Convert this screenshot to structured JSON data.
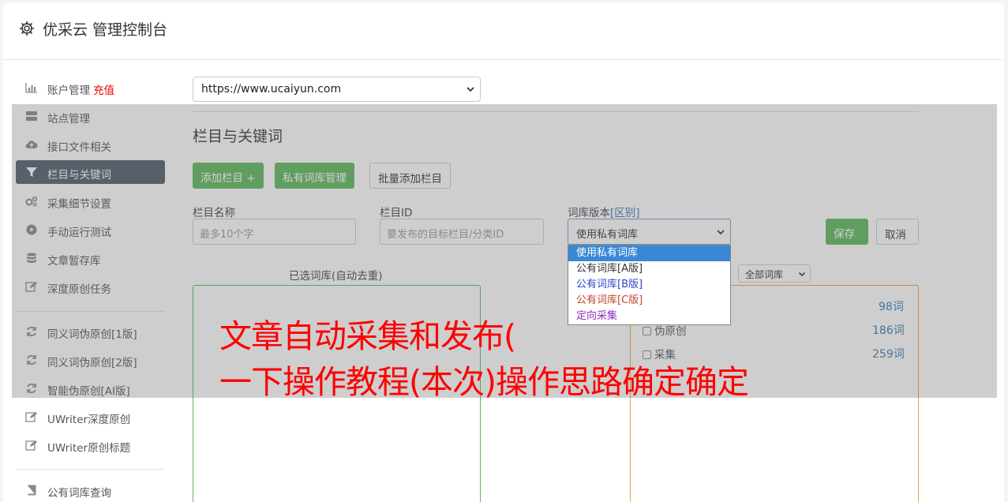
{
  "header": {
    "title": "优采云 管理控制台",
    "icon": "gear-icon"
  },
  "sidebar": {
    "items": [
      {
        "label": "账户管理",
        "extra": "充值",
        "icon": "bar-chart-icon"
      },
      {
        "label": "站点管理",
        "icon": "server-icon"
      },
      {
        "label": "接口文件相关",
        "icon": "cloud-upload-icon"
      },
      {
        "label": "栏目与关键词",
        "icon": "filter-icon",
        "active": true
      },
      {
        "label": "采集细节设置",
        "icon": "gears-icon"
      },
      {
        "label": "手动运行测试",
        "icon": "play-circle-icon"
      },
      {
        "label": "文章暂存库",
        "icon": "database-icon"
      },
      {
        "label": "深度原创任务",
        "icon": "edit-icon"
      },
      {
        "label": "同义词伪原创[1版]",
        "icon": "refresh-icon"
      },
      {
        "label": "同义词伪原创[2版]",
        "icon": "refresh-icon"
      },
      {
        "label": "智能伪原创[AI版]",
        "icon": "refresh-icon"
      },
      {
        "label": "UWriter深度原创",
        "icon": "edit-icon"
      },
      {
        "label": "UWriter原创标题",
        "icon": "edit-icon"
      },
      {
        "label": "公有词库查询",
        "icon": "book-icon"
      }
    ]
  },
  "site_select": {
    "value": "https://www.ucaiyun.com"
  },
  "section": {
    "title": "栏目与关键词"
  },
  "toolbar": {
    "add_column": "添加栏目 +",
    "private_lib": "私有词库管理",
    "batch_add": "批量添加栏目"
  },
  "form": {
    "name_label": "栏目名称",
    "name_placeholder": "最多10个字",
    "id_label": "栏目ID",
    "id_placeholder": "要发布的目标栏目/分类ID",
    "version_label": "词库版本",
    "version_link": "[区别]",
    "version_value": "使用私有词库",
    "save": "保存",
    "cancel": "取消"
  },
  "dropdown": {
    "options": [
      {
        "label": "使用私有词库",
        "color": "#ffffff",
        "selected": true
      },
      {
        "label": "公有词库[A版]",
        "color": "#333333"
      },
      {
        "label": "公有词库[B版]",
        "color": "#2c46c8"
      },
      {
        "label": "公有词库[C版]",
        "color": "#c2452b"
      },
      {
        "label": "定向采集",
        "color": "#8a2fc0"
      }
    ]
  },
  "selected_panel": {
    "title": "已选词库(自动去重)"
  },
  "library_panel": {
    "filter": "全部词库",
    "rows": [
      {
        "label": "",
        "count": "98词"
      },
      {
        "label": "伪原创",
        "count": "186词"
      },
      {
        "label": "采集",
        "count": "259词"
      }
    ]
  },
  "caption": {
    "line1": "文章自动采集和发布(",
    "line2": "一下操作教程(本次)操作思路确定确定"
  },
  "colors": {
    "accent_green": "#5cb85c",
    "active_nav": "#4f5a6a",
    "caption_red": "#ff0000",
    "link_blue": "#337ab7"
  }
}
